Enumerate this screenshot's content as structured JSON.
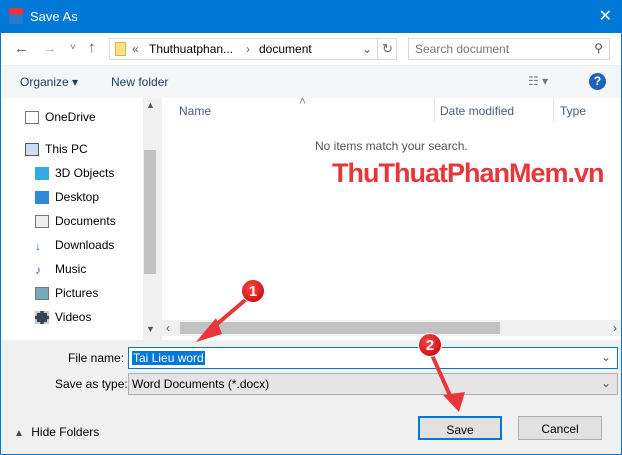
{
  "window": {
    "title": "Save As",
    "close": "✕"
  },
  "nav": {
    "back": "←",
    "forward": "→",
    "recent": "˅",
    "up": "↑",
    "breadcrumb_prefix": "«",
    "crumbs": [
      "Thuthuatphan...",
      "document"
    ],
    "sep": "›",
    "refresh": "↻",
    "search_placeholder": "Search document"
  },
  "toolbar": {
    "organize": "Organize ▾",
    "new_folder": "New folder",
    "help": "?"
  },
  "sidebar": {
    "items": [
      {
        "label": "OneDrive",
        "icon": "onedrive-icon"
      },
      {
        "label": "This PC",
        "icon": "pc-icon"
      },
      {
        "label": "3D Objects",
        "icon": "cube-icon"
      },
      {
        "label": "Desktop",
        "icon": "desktop-icon"
      },
      {
        "label": "Documents",
        "icon": "documents-icon"
      },
      {
        "label": "Downloads",
        "icon": "download-icon"
      },
      {
        "label": "Music",
        "icon": "music-icon"
      },
      {
        "label": "Pictures",
        "icon": "pictures-icon"
      },
      {
        "label": "Videos",
        "icon": "videos-icon"
      }
    ]
  },
  "columns": [
    "Name",
    "Date modified",
    "Type"
  ],
  "empty_message": "No items match your search.",
  "watermark": "ThuThuatPhanMem.vn",
  "form": {
    "file_name_label": "File name:",
    "file_name_value": "Tai Lieu word",
    "type_label": "Save as type:",
    "type_value": "Word Documents (*.docx)"
  },
  "footer": {
    "hide_folders": "Hide Folders",
    "save": "Save",
    "cancel": "Cancel"
  },
  "annotations": {
    "step1": "1",
    "step2": "2"
  },
  "colors": {
    "accent": "#0078d7",
    "annotation": "#e8363a"
  }
}
